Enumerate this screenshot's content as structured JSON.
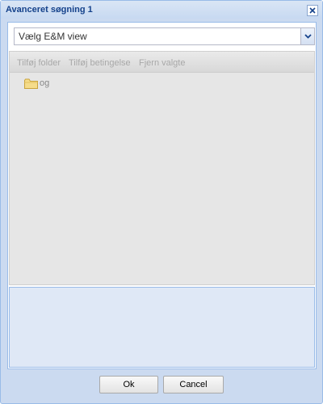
{
  "window": {
    "title": "Avanceret søgning 1",
    "close_icon": "close-icon"
  },
  "view_select": {
    "value": "Vælg E&M view",
    "trigger_icon": "chevron-down-icon"
  },
  "toolbar": {
    "add_folder": "Tilføj folder",
    "add_condition": "Tilføj betingelse",
    "remove_selected": "Fjern valgte",
    "disabled": true
  },
  "tree": {
    "nodes": [
      {
        "label": "og",
        "icon": "folder-icon"
      }
    ]
  },
  "footer": {
    "ok_label": "Ok",
    "cancel_label": "Cancel"
  },
  "colors": {
    "title_text": "#15428b",
    "window_bg": "#cbdaf0",
    "border": "#99bbe8",
    "tree_bg": "#e6e6e6",
    "lower_panel_bg": "#dfe8f6",
    "disabled_text": "#a8a8a8"
  }
}
